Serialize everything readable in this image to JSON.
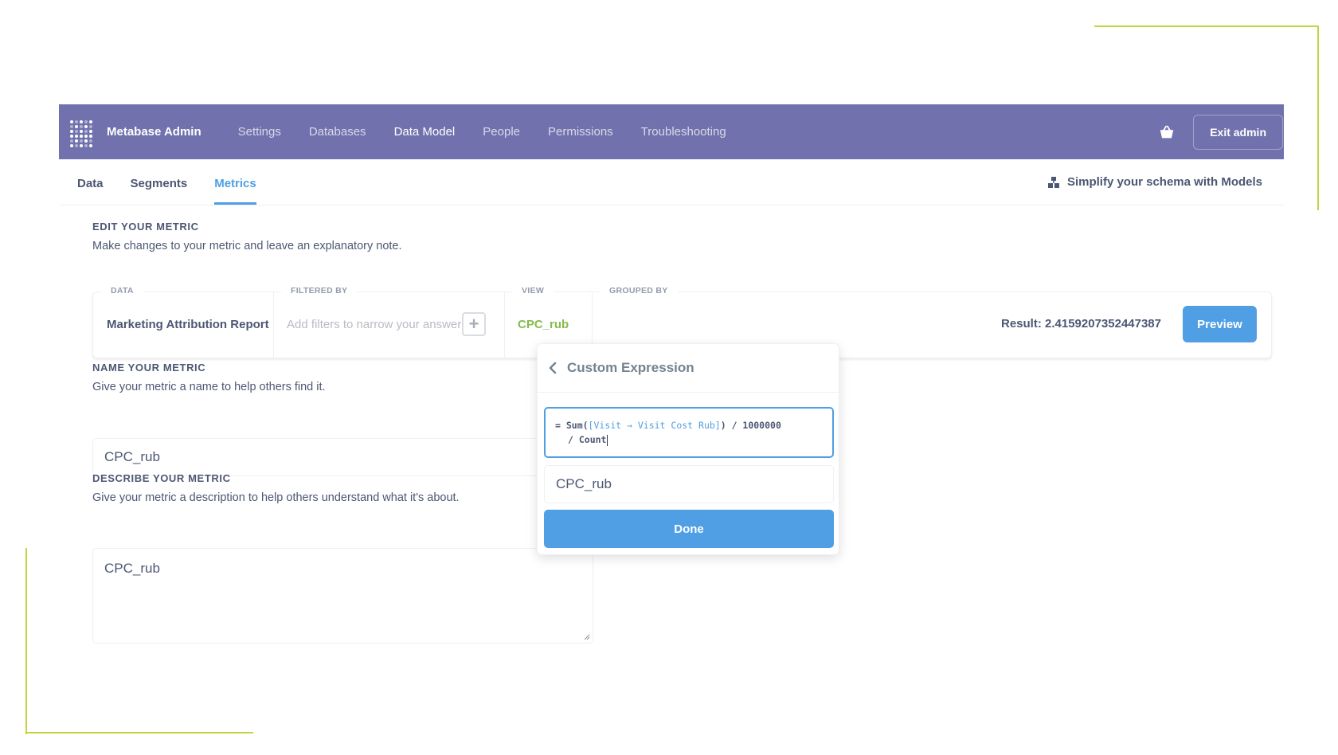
{
  "topnav": {
    "brand": "Metabase Admin",
    "links": [
      "Settings",
      "Databases",
      "Data Model",
      "People",
      "Permissions",
      "Troubleshooting"
    ],
    "active_link": "Data Model",
    "exit_label": "Exit admin",
    "basket_icon": "basket-icon"
  },
  "subnav": {
    "tabs": [
      "Data",
      "Segments",
      "Metrics"
    ],
    "active_tab": "Metrics",
    "simplify_label": "Simplify your schema with Models"
  },
  "edit": {
    "title": "EDIT YOUR METRIC",
    "desc": "Make changes to your metric and leave an explanatory note."
  },
  "query": {
    "data_label": "DATA",
    "data_value": "Marketing Attribution Report",
    "filter_label": "FILTERED BY",
    "filter_placeholder": "Add filters to narrow your answer",
    "view_label": "VIEW",
    "view_value": "CPC_rub",
    "grouped_label": "GROUPED BY",
    "result": "Result: 2.4159207352447387",
    "preview_label": "Preview",
    "view_color": "#84bb4c"
  },
  "name": {
    "title": "NAME YOUR METRIC",
    "desc": "Give your metric a name to help others find it.",
    "value": "CPC_rub"
  },
  "describe": {
    "title": "DESCRIBE YOUR METRIC",
    "desc": "Give your metric a description to help others understand what it's about.",
    "value": "CPC_rub"
  },
  "popover": {
    "title": "Custom Expression",
    "expr_prefix": "= Sum(",
    "expr_field": "[Visit → Visit Cost Rub]",
    "expr_suffix": ") / 1000000",
    "expr_line2": "/ Count",
    "name_value": "CPC_rub",
    "done_label": "Done"
  },
  "colors": {
    "nav_bg": "#7172ad",
    "brand_blue": "#509ee3",
    "accent_green": "#84bb4c",
    "deco_line": "#c4d43f"
  }
}
